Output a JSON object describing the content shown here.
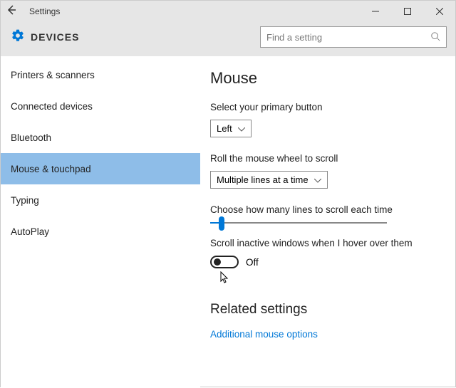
{
  "titlebar": {
    "title": "Settings"
  },
  "header": {
    "title": "DEVICES",
    "search_placeholder": "Find a setting"
  },
  "sidebar": {
    "items": [
      {
        "label": "Printers & scanners"
      },
      {
        "label": "Connected devices"
      },
      {
        "label": "Bluetooth"
      },
      {
        "label": "Mouse & touchpad"
      },
      {
        "label": "Typing"
      },
      {
        "label": "AutoPlay"
      }
    ]
  },
  "main": {
    "page_title": "Mouse",
    "primary_label": "Select your primary button",
    "primary_value": "Left",
    "scroll_label": "Roll the mouse wheel to scroll",
    "scroll_value": "Multiple lines at a time",
    "lines_label": "Choose how many lines to scroll each time",
    "hover_label": "Scroll inactive windows when I hover over them",
    "hover_value": "Off",
    "related_title": "Related settings",
    "link": "Additional mouse options"
  }
}
